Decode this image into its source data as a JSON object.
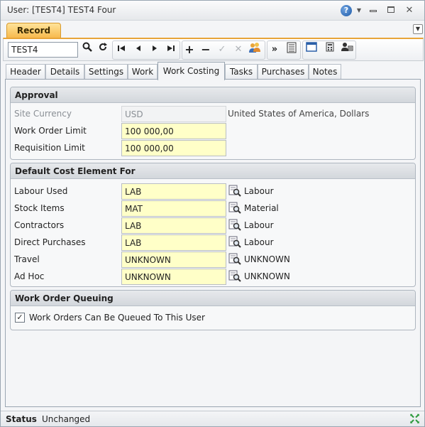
{
  "window": {
    "title": "User: [TEST4] TEST4 Four",
    "help_label": "?"
  },
  "ribbon": {
    "record_tab": "Record"
  },
  "toolbar": {
    "record_value": "TEST4",
    "icons": [
      "search-icon",
      "refresh-icon",
      "first-record-icon",
      "previous-record-icon",
      "next-record-icon",
      "last-record-icon",
      "add-icon",
      "remove-icon",
      "confirm-icon",
      "cancel-icon",
      "users-icon",
      "more-icon",
      "list-view-icon",
      "window-icon",
      "calculator-icon",
      "user-card-icon"
    ]
  },
  "tabs": [
    "Header",
    "Details",
    "Settings",
    "Work",
    "Work Costing",
    "Tasks",
    "Purchases",
    "Notes"
  ],
  "active_tab": "Work Costing",
  "approval": {
    "heading": "Approval",
    "site_currency_label": "Site Currency",
    "site_currency_value": "USD",
    "site_currency_desc": "United States of America, Dollars",
    "work_order_limit_label": "Work Order Limit",
    "work_order_limit_value": "100 000,00",
    "requisition_limit_label": "Requisition Limit",
    "requisition_limit_value": "100 000,00"
  },
  "cost_elements": {
    "heading": "Default Cost Element For",
    "rows": [
      {
        "label": "Labour Used",
        "value": "LAB",
        "desc": "Labour"
      },
      {
        "label": "Stock Items",
        "value": "MAT",
        "desc": "Material"
      },
      {
        "label": "Contractors",
        "value": "LAB",
        "desc": "Labour"
      },
      {
        "label": "Direct Purchases",
        "value": "LAB",
        "desc": "Labour"
      },
      {
        "label": "Travel",
        "value": "UNKNOWN",
        "desc": "UNKNOWN"
      },
      {
        "label": "Ad Hoc",
        "value": "UNKNOWN",
        "desc": "UNKNOWN"
      }
    ]
  },
  "queuing": {
    "heading": "Work Order Queuing",
    "checkbox_label": "Work Orders Can Be Queued To This User",
    "checked": true,
    "check_mark": "✓"
  },
  "status": {
    "label": "Status",
    "value": "Unchanged"
  },
  "colors": {
    "required_field": "#ffffc8",
    "accent_orange": "#f7b84a"
  }
}
